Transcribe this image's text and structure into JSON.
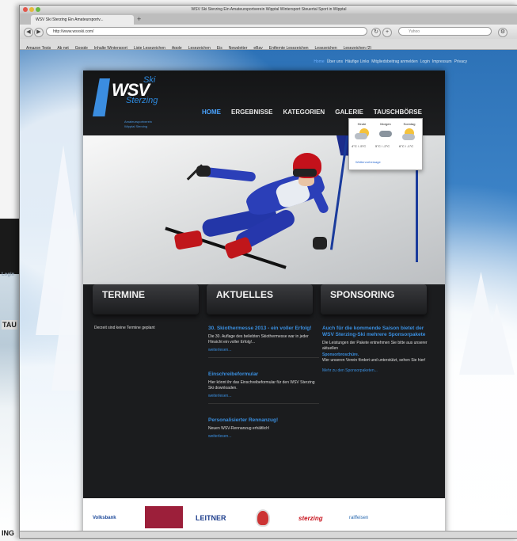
{
  "left_window": {
    "text1": "Login",
    "text2": "TAU",
    "text3": "ING"
  },
  "browser": {
    "title": "WSV Ski Sterzing Ein Amateursportverein Wipptal Wintersport Steuertal Sport in Wipptal",
    "tab_label": "WSV Ski Sterzing Ein Amateursportv...",
    "tab_new": "+",
    "url": "http://www.wsvski.com/",
    "search_placeholder": "Yahoo",
    "nav": {
      "back": "◀",
      "forward": "▶",
      "reload": "↻",
      "add": "+"
    },
    "bookmarks": [
      "Amazon Tests",
      "Ab net",
      "Google",
      "Inhalte Wintersport",
      "Liste Lesezeichen",
      "Apple",
      "Lesezeichen",
      "Eis",
      "Newsletter",
      "eBay",
      "Entfernte Lesezeichen",
      "Lesezeichen",
      "Lesezeichen (2)"
    ]
  },
  "top_links": {
    "home": "Home",
    "items": [
      "Über uns",
      "Häufige Links",
      "Mitgliedsbeitrag anmelden",
      "Login",
      "Impressum",
      "Privacy"
    ]
  },
  "logo": {
    "wsv": "WSV",
    "ski": "Ski",
    "sterzing": "Sterzing",
    "sub1": "Amateursportverein",
    "sub2": "Wipptal Sterzing"
  },
  "main_nav": {
    "items": [
      "HOME",
      "ERGEBNISSE",
      "KATEGORIEN",
      "GALERIE",
      "TAUSCHBÖRSE"
    ]
  },
  "weather": {
    "days": [
      "Heute",
      "Morgen",
      "Sonntag"
    ],
    "temps": [
      "4°C / -5°C",
      "5°C / -2°C",
      "6°C / -1°C"
    ],
    "link": "Wettervorhersage"
  },
  "columns": {
    "termine": {
      "title": "TERMINE",
      "text": "Derzeit sind keine Termine geplant"
    },
    "aktuelles": {
      "title": "AKTUELLES",
      "items": [
        {
          "h": "30. Skiothermesse 2013 - ein voller Erfolg!",
          "text": "Die 30. Auflage des beliebten Skiothermesse war in jeder Hinsicht ein voller Erfolg!...",
          "more": "weiterlesen..."
        },
        {
          "h": "Einschreibeformular",
          "text": "Hier könnt ihr das Einschreibeformular für den WSV Sterzing Ski downloaden.",
          "more": "weiterlesen..."
        },
        {
          "h": "Personalisierter Rennanzug!",
          "text": "Neuen WSV-Rennanzug erhältlich!",
          "more": "weiterlesen..."
        }
      ]
    },
    "sponsoring": {
      "title": "SPONSORING",
      "h": "Auch für die kommende Saison bietet der WSV Sterzing-Ski mehrere Sponsorpakete",
      "text1": "Die Leistungen der Pakete entnehmen Sie bitte aus unserer aktuellen",
      "highlight": "Sponsorbroschüre.",
      "text2": "Wer unseren Verein fördert und unterstützt, sehen Sie hier!",
      "more": "Mehr zu den Sponsorpaketen..."
    }
  },
  "sponsors": [
    "Volksbank",
    "",
    "LEITNER",
    "",
    "sterzing",
    "raiffeisen"
  ],
  "colors": {
    "accent": "#3a8fe0",
    "dark": "#1b1c1e",
    "sponsor_red": "#9c1f3a"
  }
}
